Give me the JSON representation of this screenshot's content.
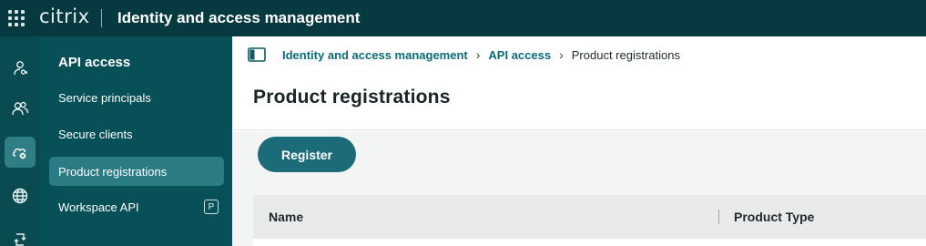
{
  "topbar": {
    "logo_text": "citrix",
    "app_title": "Identity and access management",
    "apps_icon": "app-grid-icon"
  },
  "rail": {
    "items": [
      {
        "icon": "user-key-icon",
        "active": false
      },
      {
        "icon": "users-icon",
        "active": false
      },
      {
        "icon": "cloud-gear-icon",
        "active": true
      },
      {
        "icon": "globe-icon",
        "active": false
      },
      {
        "icon": "sync-icon",
        "active": false
      }
    ]
  },
  "subnav": {
    "title": "API access",
    "items": [
      {
        "label": "Service principals",
        "active": false
      },
      {
        "label": "Secure clients",
        "active": false
      },
      {
        "label": "Product registrations",
        "active": true
      },
      {
        "label": "Workspace API",
        "active": false,
        "badge": "P"
      }
    ]
  },
  "breadcrumb": {
    "items": [
      {
        "label": "Identity and access management",
        "link": true
      },
      {
        "label": "API access",
        "link": true
      },
      {
        "label": "Product registrations",
        "link": false
      }
    ],
    "separator": "›"
  },
  "page": {
    "title": "Product registrations",
    "register_label": "Register"
  },
  "table": {
    "columns": [
      "Name",
      "Product Type"
    ]
  },
  "colors": {
    "topbar": "#063a40",
    "rail": "#0a4a51",
    "subnav": "#075057",
    "accent": "#1b6c78",
    "link": "#0a6c75"
  }
}
